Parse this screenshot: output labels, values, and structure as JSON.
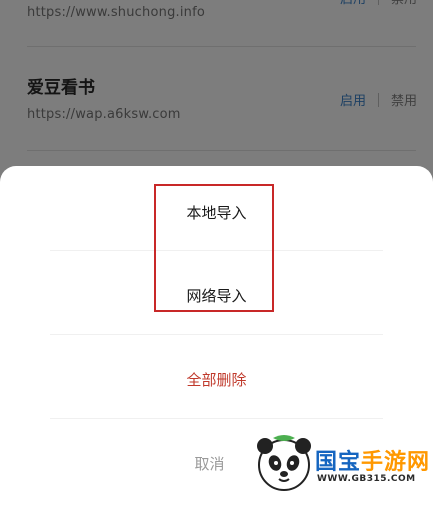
{
  "sources": [
    {
      "name": "",
      "url": "https://www.shuchong.info",
      "enable_label": "启用",
      "disable_label": "禁用"
    },
    {
      "name": "爱豆看书",
      "url": "https://wap.a6ksw.com",
      "enable_label": "启用",
      "disable_label": "禁用"
    }
  ],
  "sheet": {
    "local_import": "本地导入",
    "network_import": "网络导入",
    "delete_all": "全部删除",
    "cancel": "取消"
  },
  "watermark": {
    "brand_1": "国宝",
    "brand_2": "手游网",
    "site": "WWW.GB315.COM"
  },
  "colors": {
    "delete_text": "#c0392b",
    "highlight_border": "#c82828",
    "enable_text": "#1c3f63"
  }
}
